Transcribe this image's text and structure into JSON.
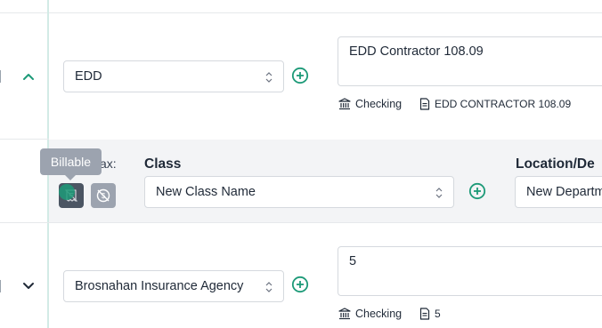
{
  "row1": {
    "account_select": "EDD",
    "memo_text": "EDD Contractor 108.09",
    "bank_label": "Checking",
    "doc_label": "EDD CONTRACTOR 108.09"
  },
  "detail": {
    "tax_label": "ax:",
    "tooltip": "Billable",
    "class_label": "Class",
    "class_select": "New Class Name",
    "location_label": "Location/De",
    "location_select": "New Departm"
  },
  "row2": {
    "account_select": "Brosnahan Insurance Agency",
    "memo_text": "5",
    "bank_label": "Checking",
    "doc_label": "5"
  },
  "colors": {
    "accent": "#1d9a78",
    "icon_dark": "#4b5563",
    "icon_gray": "#9ca3af",
    "band": "#f3f4f6"
  }
}
